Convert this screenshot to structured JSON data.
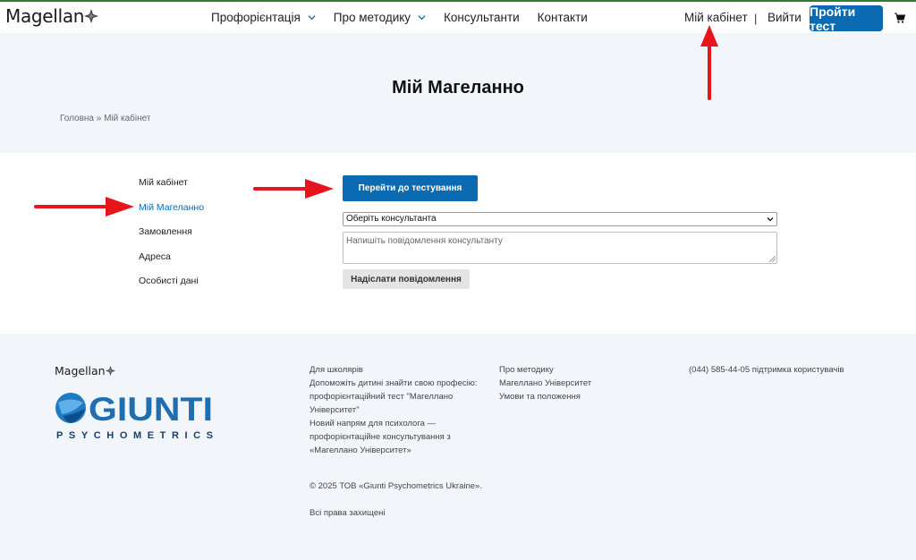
{
  "header": {
    "logo_text": "Magellan",
    "nav": [
      {
        "label": "Профорієнтація",
        "has_dropdown": true
      },
      {
        "label": "Про методику",
        "has_dropdown": true
      },
      {
        "label": "Консультанти",
        "has_dropdown": false
      },
      {
        "label": "Контакти",
        "has_dropdown": false
      }
    ],
    "my_cabinet": "Мій кабінет",
    "separator": "|",
    "logout": "Вийти",
    "cta": "Пройти тест",
    "cart_icon": "cart-icon"
  },
  "hero": {
    "title": "Мій Магеланно",
    "breadcrumb": "Головна » Мій кабінет"
  },
  "sidebar": {
    "items": [
      {
        "label": "Мій кабінет",
        "active": false
      },
      {
        "label": "Мій Магеланно",
        "active": true
      },
      {
        "label": "Замовлення",
        "active": false
      },
      {
        "label": "Адреса",
        "active": false
      },
      {
        "label": "Особисті дані",
        "active": false
      }
    ]
  },
  "main": {
    "go_test_label": "Перейти до тестування",
    "consultant_select": {
      "selected": "Оберіть консультанта"
    },
    "message": {
      "placeholder": "Напишіть повідомлення консультанту",
      "value": ""
    },
    "send_label": "Надіслати повідомлення"
  },
  "footer": {
    "logo_text": "Magellan",
    "brand": "GIUNTI",
    "brand_sub": "PSYCHOMETRICS",
    "col1": [
      "Для школярів",
      "Допоможіть дитині знайти свою професію:",
      "профорієнтаційний тест \"Магеллано",
      "Університет\"",
      "Новий напрям для психолога —",
      "профорієнтаційне консультування з",
      "«Магеллано Університет»"
    ],
    "copyright": "© 2025 ТОВ «Giunti Psychometrics Ukraine».",
    "rights": "Всі права захищені",
    "col2": [
      "Про методику",
      "Магеллано Університет",
      "Умови та положення"
    ],
    "support": "(044) 585-44-05 підтримка користувачів"
  },
  "colors": {
    "accent": "#0a6bb3",
    "annotation": "#e8141b",
    "hero_bg": "#f2f6fb",
    "top_line": "#2e7d32"
  }
}
